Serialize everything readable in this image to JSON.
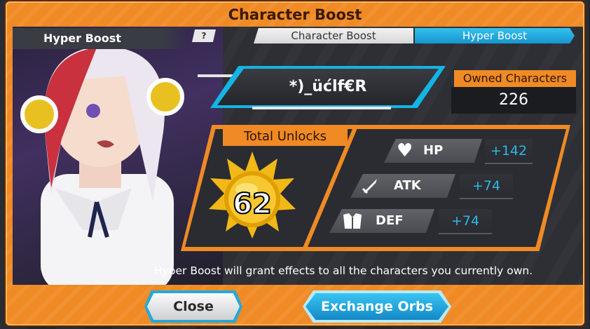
{
  "dialog": {
    "title": "Character Boost"
  },
  "left_panel": {
    "label": "Hyper Boost",
    "help_label": "?"
  },
  "tabs": [
    {
      "label": "Character Boost",
      "active": false
    },
    {
      "label": "Hyper Boost",
      "active": true
    }
  ],
  "character": {
    "name": "*)_üćlf€R"
  },
  "owned": {
    "label": "Owned Characters",
    "value": "226"
  },
  "unlocks": {
    "label": "Total Unlocks",
    "value": "62"
  },
  "stats": [
    {
      "label": "HP",
      "value": "+142",
      "icon": "heart-icon"
    },
    {
      "label": "ATK",
      "value": "+74",
      "icon": "sword-icon"
    },
    {
      "label": "DEF",
      "value": "+74",
      "icon": "armor-icon"
    }
  ],
  "note": "Hyper Boost will grant effects to all the characters you currently own.",
  "buttons": {
    "close": "Close",
    "exchange": "Exchange Orbs"
  },
  "colors": {
    "frame": "#f08a24",
    "accent": "#14b4e4",
    "stat_value": "#2bb8ea"
  }
}
